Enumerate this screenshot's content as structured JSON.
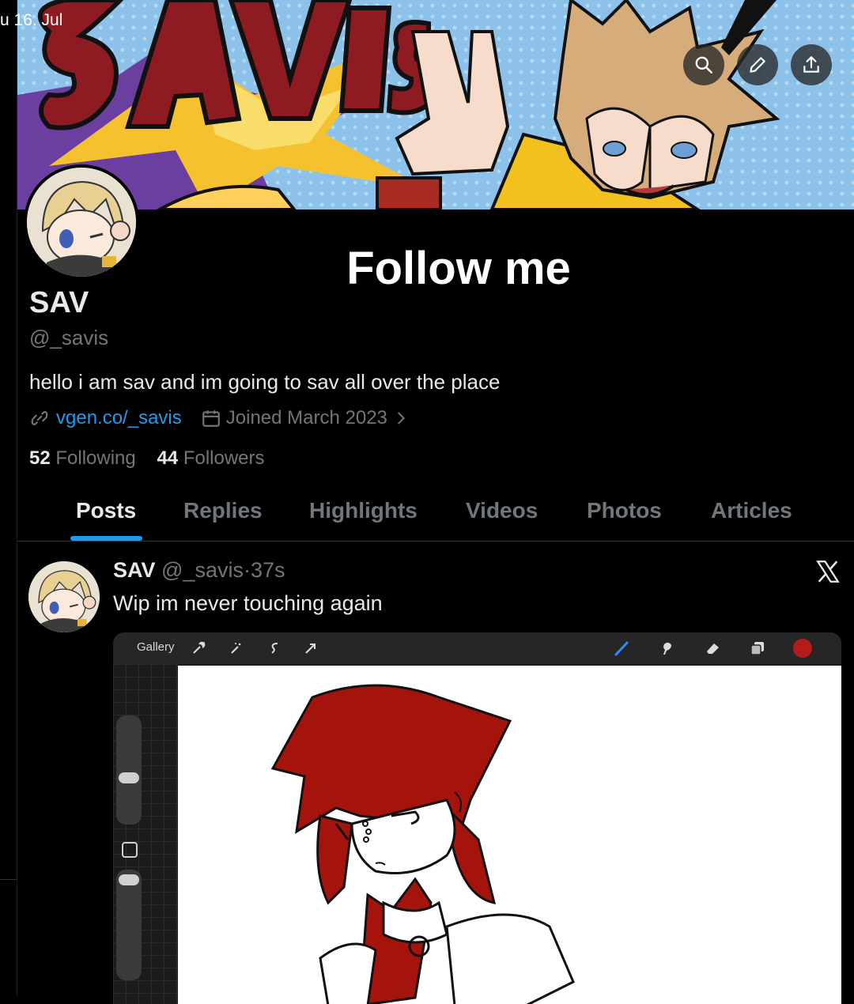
{
  "status_bar": {
    "date": "u 16. Jul"
  },
  "banner": {
    "art_text": "SAVIS",
    "buttons": [
      {
        "name": "search",
        "icon": "search-icon"
      },
      {
        "name": "edit",
        "icon": "pencil-icon"
      },
      {
        "name": "share",
        "icon": "share-icon"
      }
    ]
  },
  "overlay": {
    "title": "Follow me"
  },
  "profile": {
    "name": "SAV",
    "handle": "@_savis",
    "bio": "hello i am sav and im going to sav all over the place",
    "website": "vgen.co/_savis",
    "joined": "Joined March 2023",
    "following_count": "52",
    "following_label": "Following",
    "followers_count": "44",
    "followers_label": "Followers"
  },
  "tabs": [
    {
      "label": "Posts",
      "active": true
    },
    {
      "label": "Replies",
      "active": false
    },
    {
      "label": "Highlights",
      "active": false
    },
    {
      "label": "Videos",
      "active": false
    },
    {
      "label": "Photos",
      "active": false
    },
    {
      "label": "Articles",
      "active": false
    }
  ],
  "post": {
    "name": "SAV",
    "handle": "@_savis",
    "separator": "·",
    "time": "37s",
    "text": "Wip im never touching again",
    "media": {
      "app_toolbar": {
        "gallery_label": "Gallery"
      }
    }
  },
  "colors": {
    "accent": "#1d9bf0",
    "muted": "#71767b",
    "text": "#e7e9ea",
    "drawing_red": "#b51b1b"
  }
}
